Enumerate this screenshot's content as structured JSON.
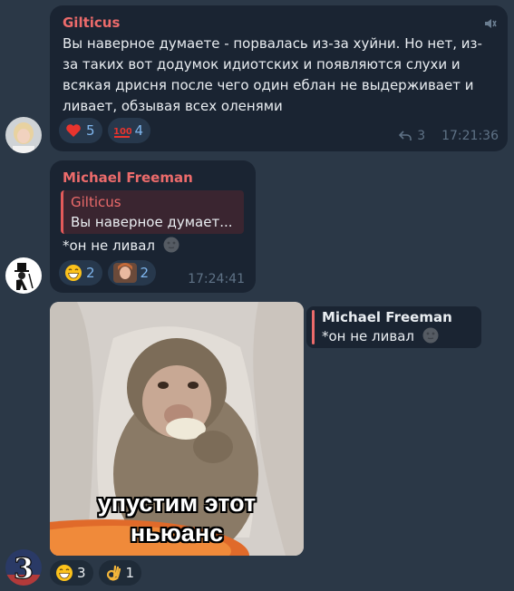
{
  "messages": [
    {
      "sender": "Gilticus",
      "text": "Вы наверное думаете - порвалась из-за хуйни. Но нет, из-за таких вот додумок идиотских и появляются слухи и всякая дрисня после чего один еблан не выдерживает и ливает, обзывая всех оленями",
      "reactions": [
        {
          "emoji": "heart",
          "count": "5"
        },
        {
          "emoji": "hundred",
          "count": "4"
        }
      ],
      "reply_count": "3",
      "time": "17:21:36",
      "avatar": "blonde-woman-avatar"
    },
    {
      "sender": "Michael Freeman",
      "reply": {
        "name": "Gilticus",
        "text": "Вы наверное думает..."
      },
      "text": "*он не ливал",
      "reactions": [
        {
          "emoji": "grin",
          "count": "2"
        },
        {
          "emoji": "avatar-photo",
          "count": "2"
        }
      ],
      "time": "17:24:41",
      "avatar": "top-hat-avatar"
    },
    {
      "reply": {
        "name": "Michael Freeman",
        "text": "*он не ливал"
      },
      "caption_line1": "упустим этот",
      "caption_line2": "ньюанс",
      "reactions": [
        {
          "emoji": "grin",
          "count": "3"
        },
        {
          "emoji": "ok-hand",
          "count": "1"
        }
      ],
      "avatar": "number-three-avatar",
      "avatar_text": "3"
    }
  ],
  "colors": {
    "background": "#2b3847",
    "bubble": "#1a2432",
    "sender": "#ec6b6b",
    "reaction_count": "#7fb6ee",
    "meta": "#5f7286"
  }
}
